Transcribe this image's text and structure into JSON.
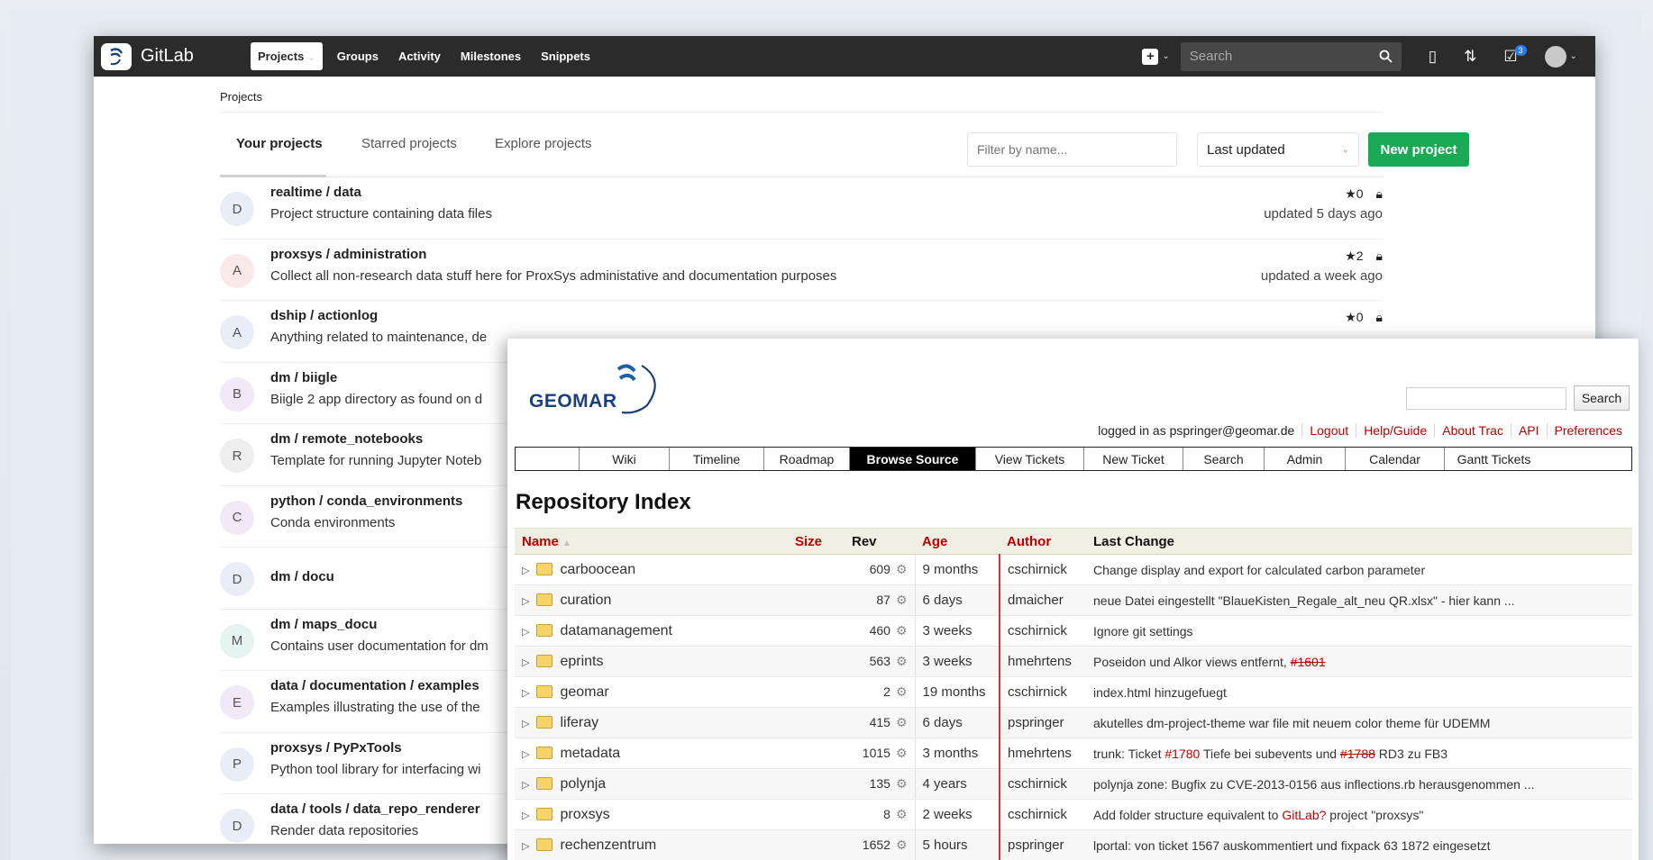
{
  "gitlab": {
    "brand": "GitLab",
    "nav": {
      "projects": "Projects",
      "groups": "Groups",
      "activity": "Activity",
      "milestones": "Milestones",
      "snippets": "Snippets"
    },
    "search_placeholder": "Search",
    "todo_count": "3",
    "breadcrumb": "Projects",
    "tabs": {
      "yours": "Your projects",
      "starred": "Starred projects",
      "explore": "Explore projects"
    },
    "filter_placeholder": "Filter by name...",
    "sort": "Last updated",
    "new_project": "New project",
    "projects": [
      {
        "letter": "D",
        "color": "#e8edf8",
        "name": "realtime / data",
        "desc": "Project structure containing data files",
        "stars": "0",
        "updated": "updated 5 days ago"
      },
      {
        "letter": "A",
        "color": "#fbe9ea",
        "name": "proxsys / administration",
        "desc": "Collect all non-research data stuff here for ProxSys administative and documentation purposes",
        "stars": "2",
        "updated": "updated a week ago"
      },
      {
        "letter": "A",
        "color": "#e8edf8",
        "name": "dship / actionlog",
        "desc": "Anything related to maintenance, de",
        "stars": "0",
        "updated": ""
      },
      {
        "letter": "B",
        "color": "#f1e8f8",
        "name": "dm / biigle",
        "desc": "Biigle 2 app directory as found on d",
        "stars": "",
        "updated": ""
      },
      {
        "letter": "R",
        "color": "#eeeeee",
        "name": "dm / remote_notebooks",
        "desc": "Template for running Jupyter Noteb",
        "stars": "",
        "updated": ""
      },
      {
        "letter": "C",
        "color": "#f1e8f8",
        "name": "python / conda_environments",
        "desc": "Conda environments",
        "stars": "",
        "updated": ""
      },
      {
        "letter": "D",
        "color": "#e8edf8",
        "name": "dm / docu",
        "desc": "",
        "stars": "",
        "updated": ""
      },
      {
        "letter": "M",
        "color": "#e6f4f1",
        "name": "dm / maps_docu",
        "desc": "Contains user documentation for dm",
        "stars": "",
        "updated": ""
      },
      {
        "letter": "E",
        "color": "#f1e8f8",
        "name": "data / documentation / examples",
        "desc": "Examples illustrating the use of the",
        "stars": "",
        "updated": ""
      },
      {
        "letter": "P",
        "color": "#e8edf8",
        "name": "proxsys / PyPxTools",
        "desc": "Python tool library for interfacing wi",
        "stars": "",
        "updated": ""
      },
      {
        "letter": "D",
        "color": "#e8edf8",
        "name": "data / tools / data_repo_renderer",
        "desc": "Render data repositories",
        "stars": "",
        "updated": ""
      }
    ]
  },
  "trac": {
    "logo_text": "GEOMAR",
    "search_button": "Search",
    "meta_nav": {
      "logged_in": "logged in as pspringer@geomar.de",
      "logout": "Logout",
      "help": "Help/Guide",
      "about": "About Trac",
      "api": "API",
      "prefs": "Preferences"
    },
    "main_nav": [
      "Wiki",
      "Timeline",
      "Roadmap",
      "Browse Source",
      "View Tickets",
      "New Ticket",
      "Search",
      "Admin",
      "Calendar",
      "Gantt Tickets"
    ],
    "title": "Repository Index",
    "columns": {
      "name": "Name",
      "size": "Size",
      "rev": "Rev",
      "age": "Age",
      "author": "Author",
      "last_change": "Last Change"
    },
    "sort_indicator": "▲",
    "rows": [
      {
        "name": "carboocean",
        "rev": "609",
        "age": "9 months",
        "author": "cschirnick",
        "change": "Change display and export for calculated carbon parameter"
      },
      {
        "name": "curation",
        "rev": "87",
        "age": "6 days",
        "author": "dmaicher",
        "change": "neue Datei eingestellt \"BlaueKisten_Regale_alt_neu QR.xlsx\" - hier kann ..."
      },
      {
        "name": "datamanagement",
        "rev": "460",
        "age": "3 weeks",
        "author": "cschirnick",
        "change": "Ignore git settings"
      },
      {
        "name": "eprints",
        "rev": "563",
        "age": "3 weeks",
        "author": "hmehrtens",
        "change": "Poseidon und Alkor views entfernt,",
        "ticket": "#1601",
        "ticket_closed": true
      },
      {
        "name": "geomar",
        "rev": "2",
        "age": "19 months",
        "author": "cschirnick",
        "change": "index.html hinzugefuegt"
      },
      {
        "name": "liferay",
        "rev": "415",
        "age": "6 days",
        "author": "pspringer",
        "change": "akutelles dm-project-theme war file mit neuem color theme für UDEMM"
      },
      {
        "name": "metadata",
        "rev": "1015",
        "age": "3 months",
        "author": "hmehrtens",
        "change_pre": "trunk: Ticket",
        "ticket1": "#1780",
        "change_mid": "Tiefe bei subevents und",
        "ticket2": "#1788",
        "change_post": "RD3 zu FB3"
      },
      {
        "name": "polynja",
        "rev": "135",
        "age": "4 years",
        "author": "cschirnick",
        "change": "polynja zone: Bugfix zu CVE-2013-0156 aus inflections.rb herausgenommen ..."
      },
      {
        "name": "proxsys",
        "rev": "8",
        "age": "2 weeks",
        "author": "cschirnick",
        "change_pre": "Add folder structure equivalent to",
        "wiki": "GitLab?",
        "change_post": "project \"proxsys\""
      },
      {
        "name": "rechenzentrum",
        "rev": "1652",
        "age": "5 hours",
        "author": "pspringer",
        "change": "lportal: von ticket 1567 auskommentiert und fixpack 63 1872 eingesetzt"
      }
    ]
  }
}
